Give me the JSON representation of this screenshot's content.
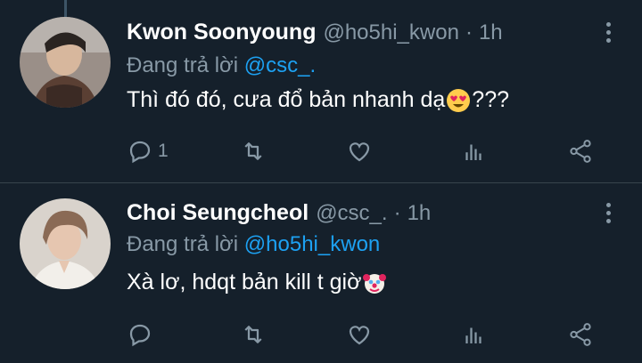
{
  "colors": {
    "background": "#15202b",
    "secondary_text": "#8899a6",
    "mention": "#1da1f2",
    "divider": "#38444d"
  },
  "tweets": [
    {
      "display_name": "Kwon Soonyoung",
      "handle": "@ho5hi_kwon",
      "separator": "·",
      "time": "1h",
      "reply_prefix": "Đang trả lời",
      "reply_to": "@csc_.",
      "text_before_emoji": "Thì đó đó, cưa đổ bản nhanh dạ",
      "emoji": "smiling-face-with-heart-eyes",
      "text_after_emoji": "???",
      "reply_count": "1",
      "icons": [
        "reply-icon",
        "retweet-icon",
        "like-icon",
        "stats-icon",
        "share-icon"
      ]
    },
    {
      "display_name": "Choi Seungcheol",
      "handle": "@csc_.",
      "separator": "·",
      "time": "1h",
      "reply_prefix": "Đang trả lời",
      "reply_to": "@ho5hi_kwon",
      "text_before_emoji": "Xà lơ, hdqt bản kill t giờ",
      "emoji": "clown-face",
      "text_after_emoji": "",
      "reply_count": "",
      "icons": [
        "reply-icon",
        "retweet-icon",
        "like-icon",
        "stats-icon",
        "share-icon"
      ]
    }
  ]
}
